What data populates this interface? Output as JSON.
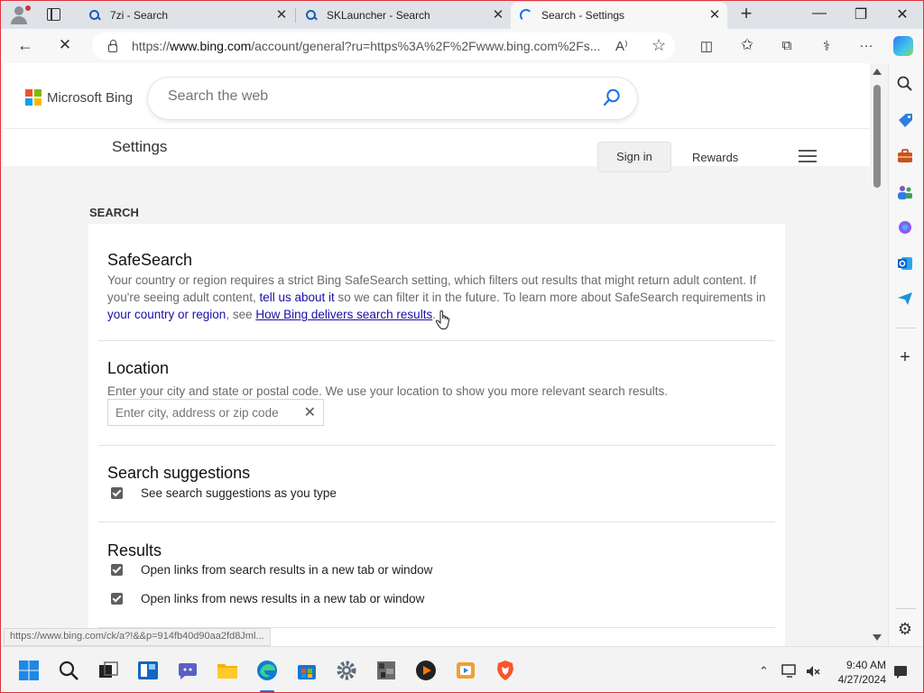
{
  "browser": {
    "tabs": [
      {
        "title": "7zi - Search",
        "active": false
      },
      {
        "title": "SKLauncher - Search",
        "active": false
      },
      {
        "title": "Search - Settings",
        "active": true
      }
    ],
    "close_glyph": "✕",
    "new_tab_glyph": "+",
    "window_controls": {
      "minimize": "—",
      "restore": "❐",
      "close": "✕"
    },
    "nav": {
      "back": "←",
      "stop": "✕"
    },
    "url": {
      "prefix": "https://",
      "host": "www.bing.com",
      "rest": "/account/general?ru=https%3A%2F%2Fwww.bing.com%2Fs..."
    },
    "url_icons": {
      "read_aloud": "A⁾",
      "favorite": "☆"
    },
    "toolbar_icons": {
      "split": "◫",
      "favorites": "✩",
      "collections": "⧉",
      "extensions": "⚕",
      "menu": "···"
    }
  },
  "header": {
    "logo_text": "Microsoft Bing",
    "logo_colors": [
      "#f25022",
      "#7fba00",
      "#00a4ef",
      "#ffb900"
    ],
    "search_placeholder": "Search the web",
    "accent": "#1a73e8"
  },
  "settings_bar": {
    "title": "Settings",
    "sign_in": "Sign in",
    "rewards": "Rewards"
  },
  "section_label": "SEARCH",
  "safesearch": {
    "heading": "SafeSearch",
    "text_1": "Your country or region requires a strict Bing SafeSearch setting, which filters out results that might return adult content. If you're seeing adult content, ",
    "link_1": "tell us about it",
    "text_2": " so we can filter it in the future. To learn more about SafeSearch requirements in ",
    "link_2": "your country or region",
    "text_3": ", see ",
    "link_3": "How Bing delivers search results",
    "text_4": "."
  },
  "location": {
    "heading": "Location",
    "description": "Enter your city and state or postal code. We use your location to show you more relevant search results.",
    "placeholder": "Enter city, address or zip code",
    "clear_glyph": "✕"
  },
  "suggestions": {
    "heading": "Search suggestions",
    "option": "See search suggestions as you type",
    "checked": true
  },
  "results": {
    "heading": "Results",
    "options": [
      {
        "label": "Open links from search results in a new tab or window",
        "checked": true
      },
      {
        "label": "Open links from news results in a new tab or window",
        "checked": true
      }
    ]
  },
  "status_url": "https://www.bing.com/ck/a?!&&p=914fb40d90aa2fd8Jml...",
  "sidebar": {
    "icons": [
      "search-icon",
      "tag-icon",
      "briefcase-icon",
      "people-icon",
      "copilot-icon",
      "outlook-icon",
      "send-icon"
    ],
    "add": "+",
    "settings": "⚙"
  },
  "taskbar": {
    "time": "9:40 AM",
    "date": "4/27/2024"
  }
}
